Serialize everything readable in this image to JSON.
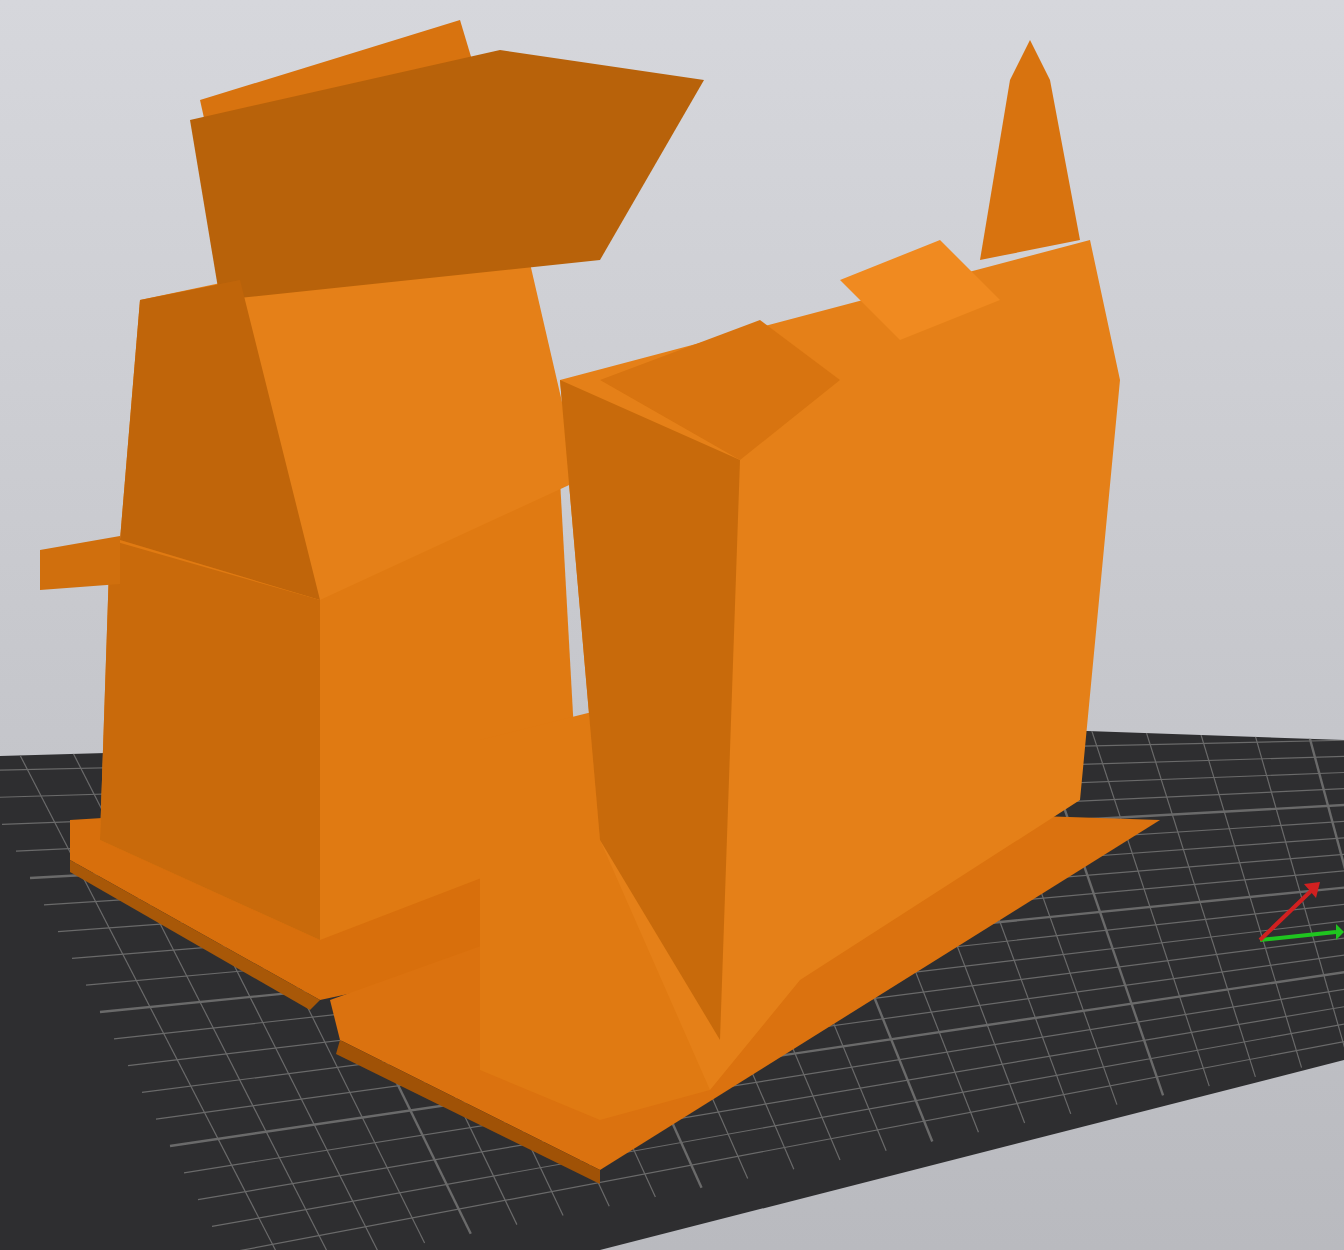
{
  "viewport": {
    "kind": "preview"
  }
}
